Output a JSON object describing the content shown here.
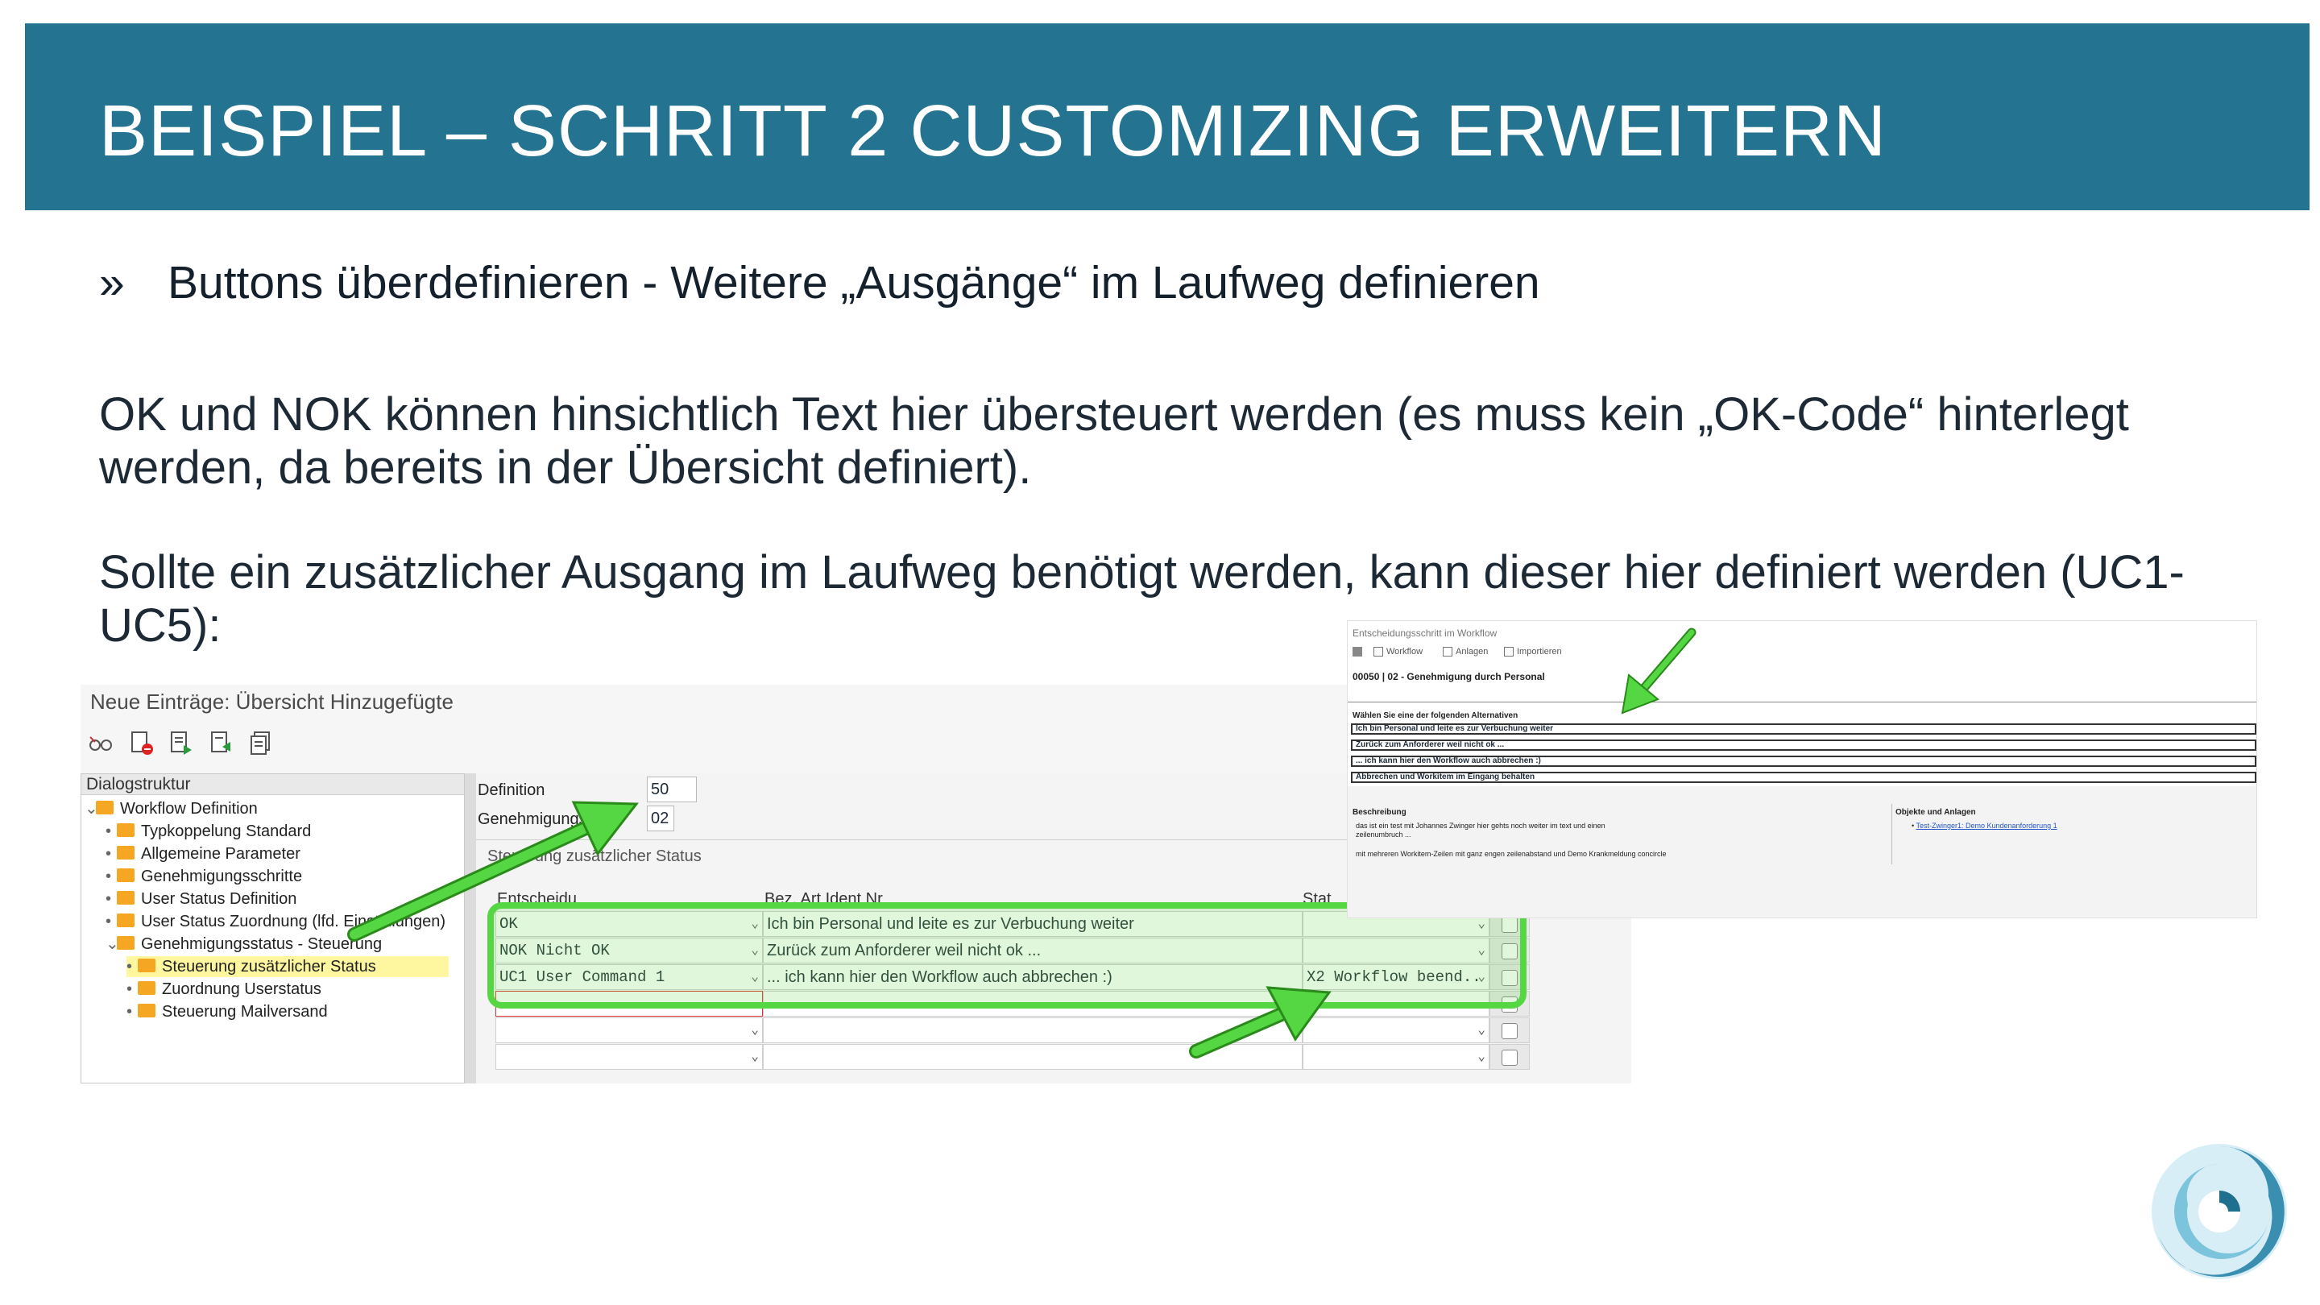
{
  "slide": {
    "title": "BEISPIEL – SCHRITT 2 CUSTOMIZING ERWEITERN",
    "bullet_symbol": "»",
    "bullet_text": "Buttons überdefinieren - Weitere „Ausgänge“ im Laufweg definieren",
    "paragraph1": "OK und NOK können hinsichtlich Text hier übersteuert werden (es muss kein „OK-Code“ hinterlegt werden, da bereits in der Übersicht definiert).",
    "paragraph2": "Sollte ein zusätzlicher Ausgang im Laufweg benötigt werden, kann dieser hier definiert werden (UC1-UC5):",
    "colors": {
      "header_bg": "#237391",
      "title": "#ffffff",
      "arrow": "#55d743"
    }
  },
  "sap": {
    "title": "Neue Einträge: Übersicht Hinzugefügte",
    "toolbar_icons": [
      "glasses-icon",
      "delete-icon",
      "export-icon",
      "import-icon",
      "copy-icon"
    ],
    "tree_header": "Dialogstruktur",
    "tree": [
      {
        "label": "Workflow Definition",
        "expanded": true
      },
      {
        "label": "Typkoppelung Standard"
      },
      {
        "label": "Allgemeine Parameter"
      },
      {
        "label": "Genehmigungsschritte"
      },
      {
        "label": "User Status Definition"
      },
      {
        "label": "User Status Zuordnung (lfd. Einstellungen)"
      },
      {
        "label": "Genehmigungsstatus - Steuerung",
        "expanded": true
      },
      {
        "label": "Steuerung zusätzlicher Status",
        "selected": true
      },
      {
        "label": "Zuordnung Userstatus"
      },
      {
        "label": "Steuerung Mailversand"
      }
    ],
    "definition_label": "Definition",
    "definition_value": "50",
    "genehmigung_label": "Genehmigungss",
    "genehmigung_value": "02",
    "group_label": "Steuerung zusätzlicher Status",
    "columns": [
      "Entscheidu",
      "Bez. Art Ident Nr",
      "Stat"
    ],
    "rows": [
      {
        "decision": "OK",
        "text": "Ich bin Personal und leite es zur Verbuchung weiter",
        "status": ""
      },
      {
        "decision": "NOK Nicht OK",
        "text": "Zurück zum Anforderer weil nicht ok ...",
        "status": ""
      },
      {
        "decision": "UC1 User Command 1",
        "text": "... ich kann hier den Workflow auch abbrechen :)",
        "status": "X2 Workflow beend.."
      },
      {
        "decision": "",
        "text": "",
        "status": ""
      },
      {
        "decision": "",
        "text": "",
        "status": ""
      },
      {
        "decision": "",
        "text": "",
        "status": ""
      }
    ]
  },
  "workflow": {
    "title": "Entscheidungsschritt im Workflow",
    "toolbar": [
      "Workflow",
      "Anlagen",
      "Importieren"
    ],
    "step": "00050 | 02 - Genehmigung durch Personal",
    "prompt": "Wählen Sie eine der folgenden Alternativen",
    "options": [
      "Ich bin Personal und leite es zur Verbuchung weiter",
      "Zurück zum Anforderer weil nicht ok ...",
      "... ich kann hier den Workflow auch abbrechen :)",
      "Abbrechen und Workitem im Eingang behalten"
    ],
    "desc_label": "Beschreibung",
    "desc_line1": "das ist ein test mit Johannes Zwinger hier gehts noch weiter im text und einen",
    "desc_line2": "zeilenumbruch ...",
    "desc_line3": "mit mehreren Workitem-Zeilen mit ganz engen zeilenabstand und Demo Krankmeldung concircle",
    "objects_label": "Objekte und Anlagen",
    "objects_link": "Test-Zwinger1: Demo Kundenanforderung 1"
  }
}
